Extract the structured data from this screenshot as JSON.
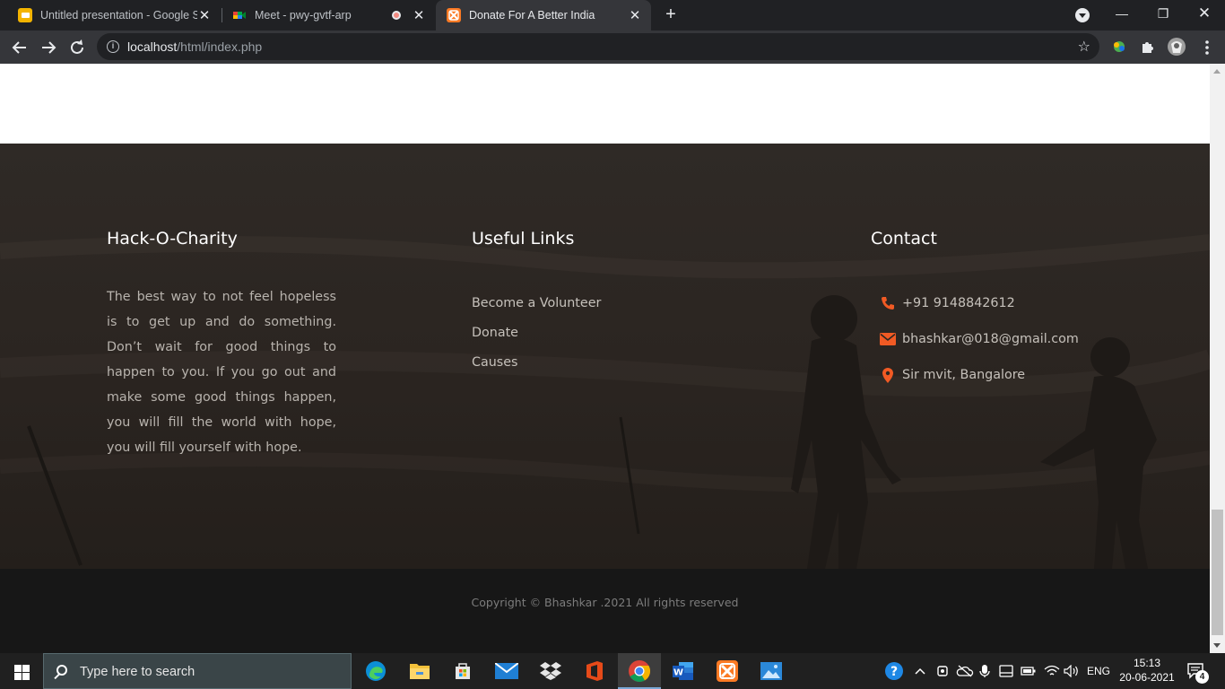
{
  "browser": {
    "tabs": [
      {
        "title": "Untitled presentation - Google Sl",
        "favicon": "google-slides-icon",
        "active": false,
        "recording": false
      },
      {
        "title": "Meet - pwy-gvtf-arp",
        "favicon": "google-meet-icon",
        "active": false,
        "recording": true
      },
      {
        "title": "Donate For A Better India",
        "favicon": "xampp-icon",
        "active": true,
        "recording": false
      }
    ],
    "new_tab_label": "+",
    "address": {
      "host": "localhost",
      "path": "/html/index.php"
    }
  },
  "footer": {
    "about": {
      "title": "Hack-O-Charity",
      "text": "The best way to not feel hopeless is to get up and do something. Don’t wait for good things to happen to you. If you go out and make some good things happen, you will fill the world with hope, you will fill yourself with hope."
    },
    "links": {
      "title": "Useful Links",
      "items": [
        "Become a Volunteer",
        "Donate",
        "Causes"
      ]
    },
    "contact": {
      "title": "Contact",
      "phone": "+91 9148842612",
      "email": "bhashkar@018@gmail.com",
      "address": "Sir mvit, Bangalore",
      "icon_color": "#f15a24"
    },
    "copyright": "Copyright © Bhashkar .2021 All rights reserved"
  },
  "taskbar": {
    "search_placeholder": "Type here to search",
    "apps": [
      "edge-icon",
      "file-explorer-icon",
      "store-icon",
      "mail-icon",
      "dropbox-icon",
      "office-icon",
      "chrome-icon",
      "word-icon",
      "xampp-icon",
      "photos-icon"
    ],
    "language": "ENG",
    "time": "15:13",
    "date": "20-06-2021",
    "notification_count": "4"
  }
}
